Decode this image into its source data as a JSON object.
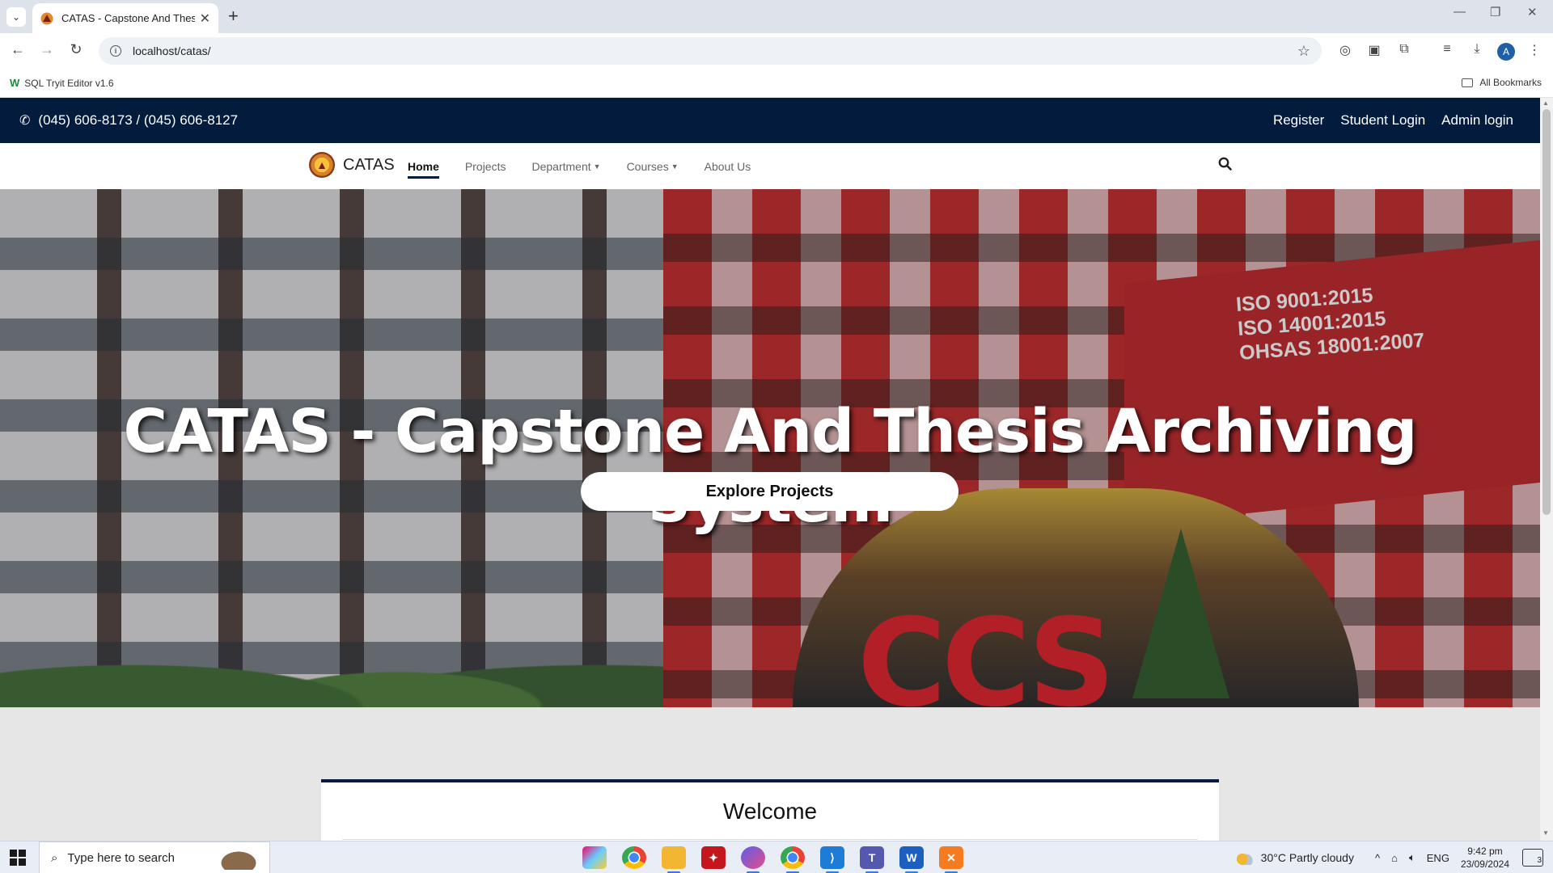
{
  "browser": {
    "tab_title": "CATAS - Capstone And Thesis A",
    "url": "localhost/catas/",
    "bookmark": "SQL Tryit Editor v1.6",
    "all_bookmarks": "All Bookmarks",
    "profile_initial": "A"
  },
  "topbar": {
    "phone": "(045) 606-8173 / (045) 606-8127",
    "links": {
      "register": "Register",
      "student_login": "Student Login",
      "admin_login": "Admin login"
    }
  },
  "navbar": {
    "brand": "CATAS",
    "links": {
      "home": "Home",
      "projects": "Projects",
      "department": "Department",
      "courses": "Courses",
      "about": "About Us"
    }
  },
  "hero": {
    "title": "CATAS - Capstone And Thesis Archiving System",
    "button": "Explore Projects",
    "iso_line1": "ISO 9001:2015",
    "iso_line2": "ISO 14001:2015",
    "iso_line3": "OHSAS 18001:2007",
    "sign": "CCS"
  },
  "welcome": {
    "heading": "Welcome"
  },
  "taskbar": {
    "search_placeholder": "Type here to search",
    "weather": "30°C  Partly cloudy",
    "lang": "ENG",
    "time": "9:42 pm",
    "date": "23/09/2024",
    "notifications": "3"
  },
  "colors": {
    "navy": "#031b3d",
    "accent_red": "#d6222a"
  }
}
